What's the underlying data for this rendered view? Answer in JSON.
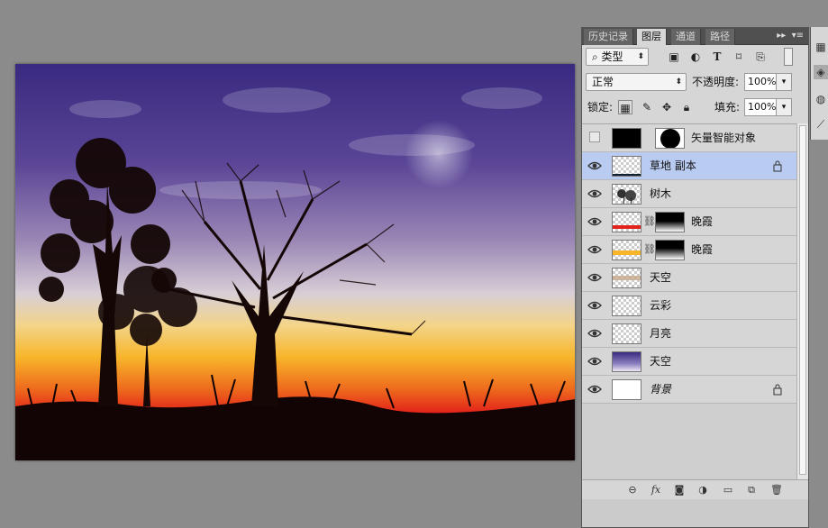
{
  "panel": {
    "tabs": [
      {
        "label": "历史记录"
      },
      {
        "label": "图层"
      },
      {
        "label": "通道"
      },
      {
        "label": "路径"
      }
    ],
    "filter": {
      "kind": "类型",
      "icon": "search-icon"
    },
    "blend_mode": "正常",
    "opacity_label": "不透明度:",
    "opacity_value": "100%",
    "lock_label": "锁定:",
    "fill_label": "填充:",
    "fill_value": "100%"
  },
  "layers": [
    {
      "name": "矢量智能对象",
      "visible": false,
      "has_mask": true,
      "selected": false,
      "locked": false,
      "italic": false
    },
    {
      "name": "草地 副本",
      "visible": true,
      "has_mask": false,
      "selected": true,
      "locked": true,
      "italic": false
    },
    {
      "name": "树木",
      "visible": true,
      "has_mask": false,
      "selected": false,
      "locked": false,
      "italic": false
    },
    {
      "name": "晚霞",
      "visible": true,
      "has_mask": true,
      "selected": false,
      "locked": false,
      "italic": false
    },
    {
      "name": "晚霞",
      "visible": true,
      "has_mask": true,
      "selected": false,
      "locked": false,
      "italic": false
    },
    {
      "name": "天空",
      "visible": true,
      "has_mask": false,
      "selected": false,
      "locked": false,
      "italic": false
    },
    {
      "name": "云彩",
      "visible": true,
      "has_mask": false,
      "selected": false,
      "locked": false,
      "italic": false
    },
    {
      "name": "月亮",
      "visible": true,
      "has_mask": false,
      "selected": false,
      "locked": false,
      "italic": false
    },
    {
      "name": "天空",
      "visible": true,
      "has_mask": false,
      "selected": false,
      "locked": false,
      "italic": false
    },
    {
      "name": "背景",
      "visible": true,
      "has_mask": false,
      "selected": false,
      "locked": true,
      "italic": true
    }
  ],
  "colors": {
    "selected_layer": "#b9cbf1",
    "sky_top": "#3b2a7e",
    "horizon_orange": "#f7b52a",
    "horizon_red": "#e2231a"
  }
}
